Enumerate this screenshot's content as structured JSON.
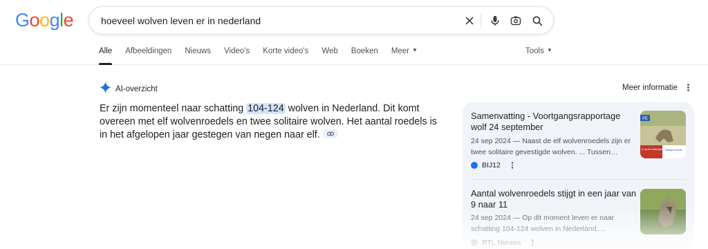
{
  "logo": {
    "letters": [
      "G",
      "o",
      "o",
      "g",
      "l",
      "e"
    ],
    "colors": [
      "#4285f4",
      "#ea4335",
      "#fbbc05",
      "#4285f4",
      "#34a853",
      "#ea4335"
    ]
  },
  "search": {
    "query": "hoeveel wolven leven er in nederland"
  },
  "tabs": [
    {
      "label": "Alle",
      "active": true
    },
    {
      "label": "Afbeeldingen"
    },
    {
      "label": "Nieuws"
    },
    {
      "label": "Video's"
    },
    {
      "label": "Korte video's"
    },
    {
      "label": "Web"
    },
    {
      "label": "Boeken"
    },
    {
      "label": "Meer",
      "dropdown": true
    }
  ],
  "tools_label": "Tools",
  "ai_overview": {
    "label": "AI-overzicht",
    "more_info": "Meer informatie",
    "answer_before": "Er zijn momenteel naar schatting ",
    "answer_highlight": "104-124",
    "answer_after": " wolven in Nederland. Dit komt overeen met elf wolvenroedels en twee solitaire wolven. Het aantal roedels is in het afgelopen jaar gestegen van negen naar elf."
  },
  "sources": [
    {
      "title": "Samenvatting - Voortgangsrapportage wolf 24 september",
      "snippet": "24 sep 2024 — Naast de elf wolvenroedels zijn er twee solitaire gevestigde wolven. ... Tussen…",
      "site": "BIJ12",
      "thumb_text_top": "PE",
      "thumb_text_red": "ie op de\nmaatregelen",
      "thumb_text_right": "Tijdelijke schade"
    },
    {
      "title": "Aantal wolvenroedels stijgt in een jaar van 9 naar 11",
      "snippet": "24 sep 2024 — Op dit moment leven er naar schatting 104-124 wolven in Nederland.…",
      "site": "RTL Nieuws"
    }
  ],
  "colors": {
    "accent": "#1a73e8",
    "highlight": "#d3e3fd",
    "panel_bg": "#f0f4f9"
  },
  "icons": [
    "clear-icon",
    "mic-icon",
    "lens-icon",
    "search-icon",
    "sparkle-icon",
    "link-icon",
    "globe-icon"
  ]
}
